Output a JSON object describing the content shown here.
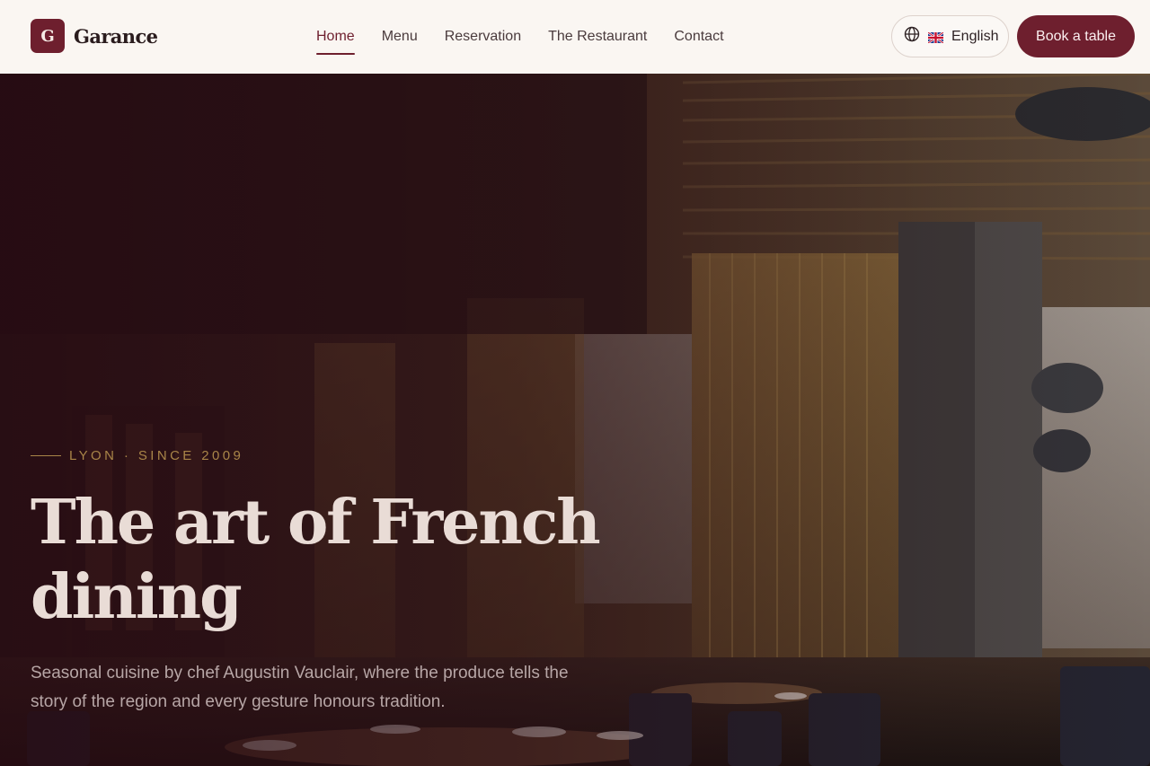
{
  "brand": {
    "logo_letter": "G",
    "name": "Garance"
  },
  "nav": {
    "items": [
      {
        "label": "Home",
        "active": true
      },
      {
        "label": "Menu",
        "active": false
      },
      {
        "label": "Reservation",
        "active": false
      },
      {
        "label": "The Restaurant",
        "active": false
      },
      {
        "label": "Contact",
        "active": false
      }
    ]
  },
  "language": {
    "label": "English",
    "icons": [
      "globe-icon",
      "uk-flag-icon"
    ]
  },
  "cta": {
    "book_label": "Book a table"
  },
  "hero": {
    "eyebrow": "LYON · SINCE 2009",
    "title": "The art of French dining",
    "subtitle": "Seasonal cuisine by chef Augustin Vauclair, where the produce tells the story of the region and every gesture honours tradition.",
    "background": "restaurant interior photo"
  },
  "colors": {
    "brand": "#6e1f2e",
    "header_bg": "#faf6f2",
    "gold_accent": "#a98548"
  }
}
